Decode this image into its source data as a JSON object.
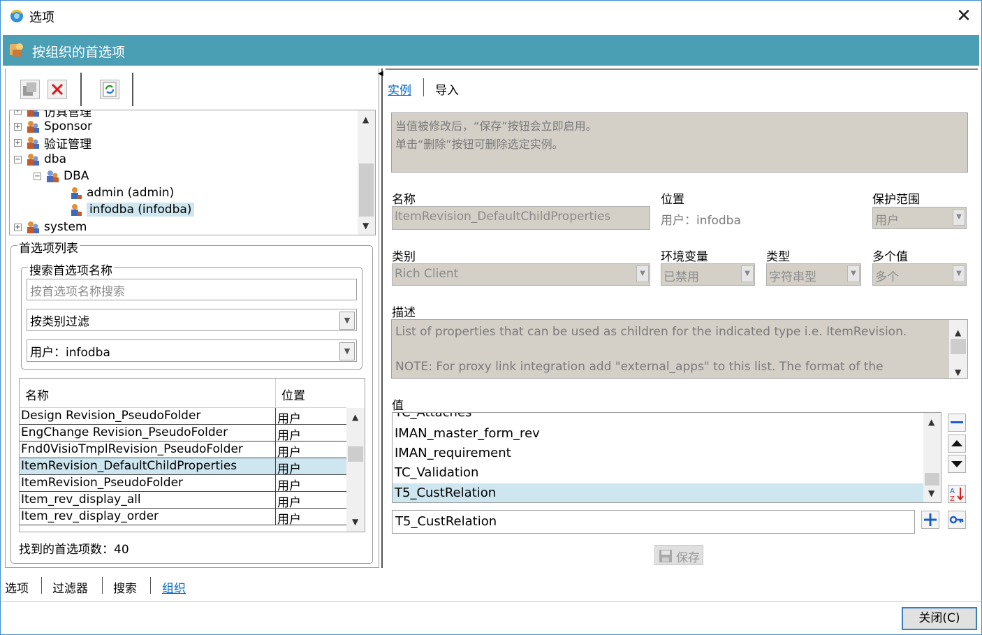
{
  "window": {
    "title": "选项",
    "close_glyph": "✕"
  },
  "header": {
    "title": "按组织的首选项"
  },
  "tree": {
    "items": [
      {
        "label": "仿真管理",
        "level": 0,
        "expander": "⊞"
      },
      {
        "label": "Sponsor",
        "level": 0,
        "expander": "⊞"
      },
      {
        "label": "验证管理",
        "level": 0,
        "expander": "⊞"
      },
      {
        "label": "dba",
        "level": 0,
        "expander": "⊟"
      },
      {
        "label": "DBA",
        "level": 1,
        "expander": "⊟"
      },
      {
        "label": "admin (admin)",
        "level": 2,
        "expander": ""
      },
      {
        "label": "infodba (infodba)",
        "level": 2,
        "expander": "",
        "selected": true
      },
      {
        "label": "system",
        "level": 0,
        "expander": "⊞"
      }
    ]
  },
  "pref_list": {
    "legend": "首选项列表",
    "search_legend": "搜索首选项名称",
    "search_placeholder": "按首选项名称搜索",
    "filter_category": "按类别过滤",
    "filter_scope": "用户：infodba",
    "columns": [
      "名称",
      "位置"
    ],
    "rows": [
      {
        "name": "Design Revision_PseudoFolder",
        "loc": "用户"
      },
      {
        "name": "EngChange Revision_PseudoFolder",
        "loc": "用户"
      },
      {
        "name": "Fnd0VisioTmplRevision_PseudoFolder",
        "loc": "用户"
      },
      {
        "name": "ItemRevision_DefaultChildProperties",
        "loc": "用户",
        "selected": true
      },
      {
        "name": "ItemRevision_PseudoFolder",
        "loc": "用户"
      },
      {
        "name": "Item_rev_display_all",
        "loc": "用户"
      },
      {
        "name": "Item_rev_display_order",
        "loc": "用户"
      }
    ],
    "count_label": "找到的首选项数：40"
  },
  "bottom_tabs": {
    "t1": "选项",
    "t2": "过滤器",
    "t3": "搜索",
    "t4": "组织"
  },
  "right": {
    "tab_instance": "实例",
    "tab_import": "导入",
    "info_line1": "当值被修改后，“保存”按钮会立即启用。",
    "info_line2": "单击“删除”按钮可删除选定实例。",
    "name_label": "名称",
    "name_value": "ItemRevision_DefaultChildProperties",
    "location_label": "位置",
    "location_value": "用户：infodba",
    "protect_label": "保护范围",
    "protect_value": "用户",
    "category_label": "类别",
    "category_value": "Rich Client",
    "env_label": "环境变量",
    "env_value": "已禁用",
    "type_label": "类型",
    "type_value": "字符串型",
    "multi_label": "多个值",
    "multi_value": "多个",
    "desc_label": "描述",
    "desc_line1": "List of properties that can be used as children for the indicated type i.e. ItemRevision.",
    "desc_line2": "NOTE: For proxy link integration add \"external_apps\" to this list. The format of the",
    "value_label": "值",
    "values": [
      "TC_Attaches",
      "IMAN_master_form_rev",
      "IMAN_requirement",
      "TC_Validation",
      "T5_CustRelation"
    ],
    "value_input": "T5_CustRelation",
    "save_label": "保存"
  },
  "close_button": "关闭(C)",
  "colors": {
    "header_band": "#4a9fb4",
    "selection": "#cde6ef",
    "disabled_bg": "#d4d0c8"
  }
}
